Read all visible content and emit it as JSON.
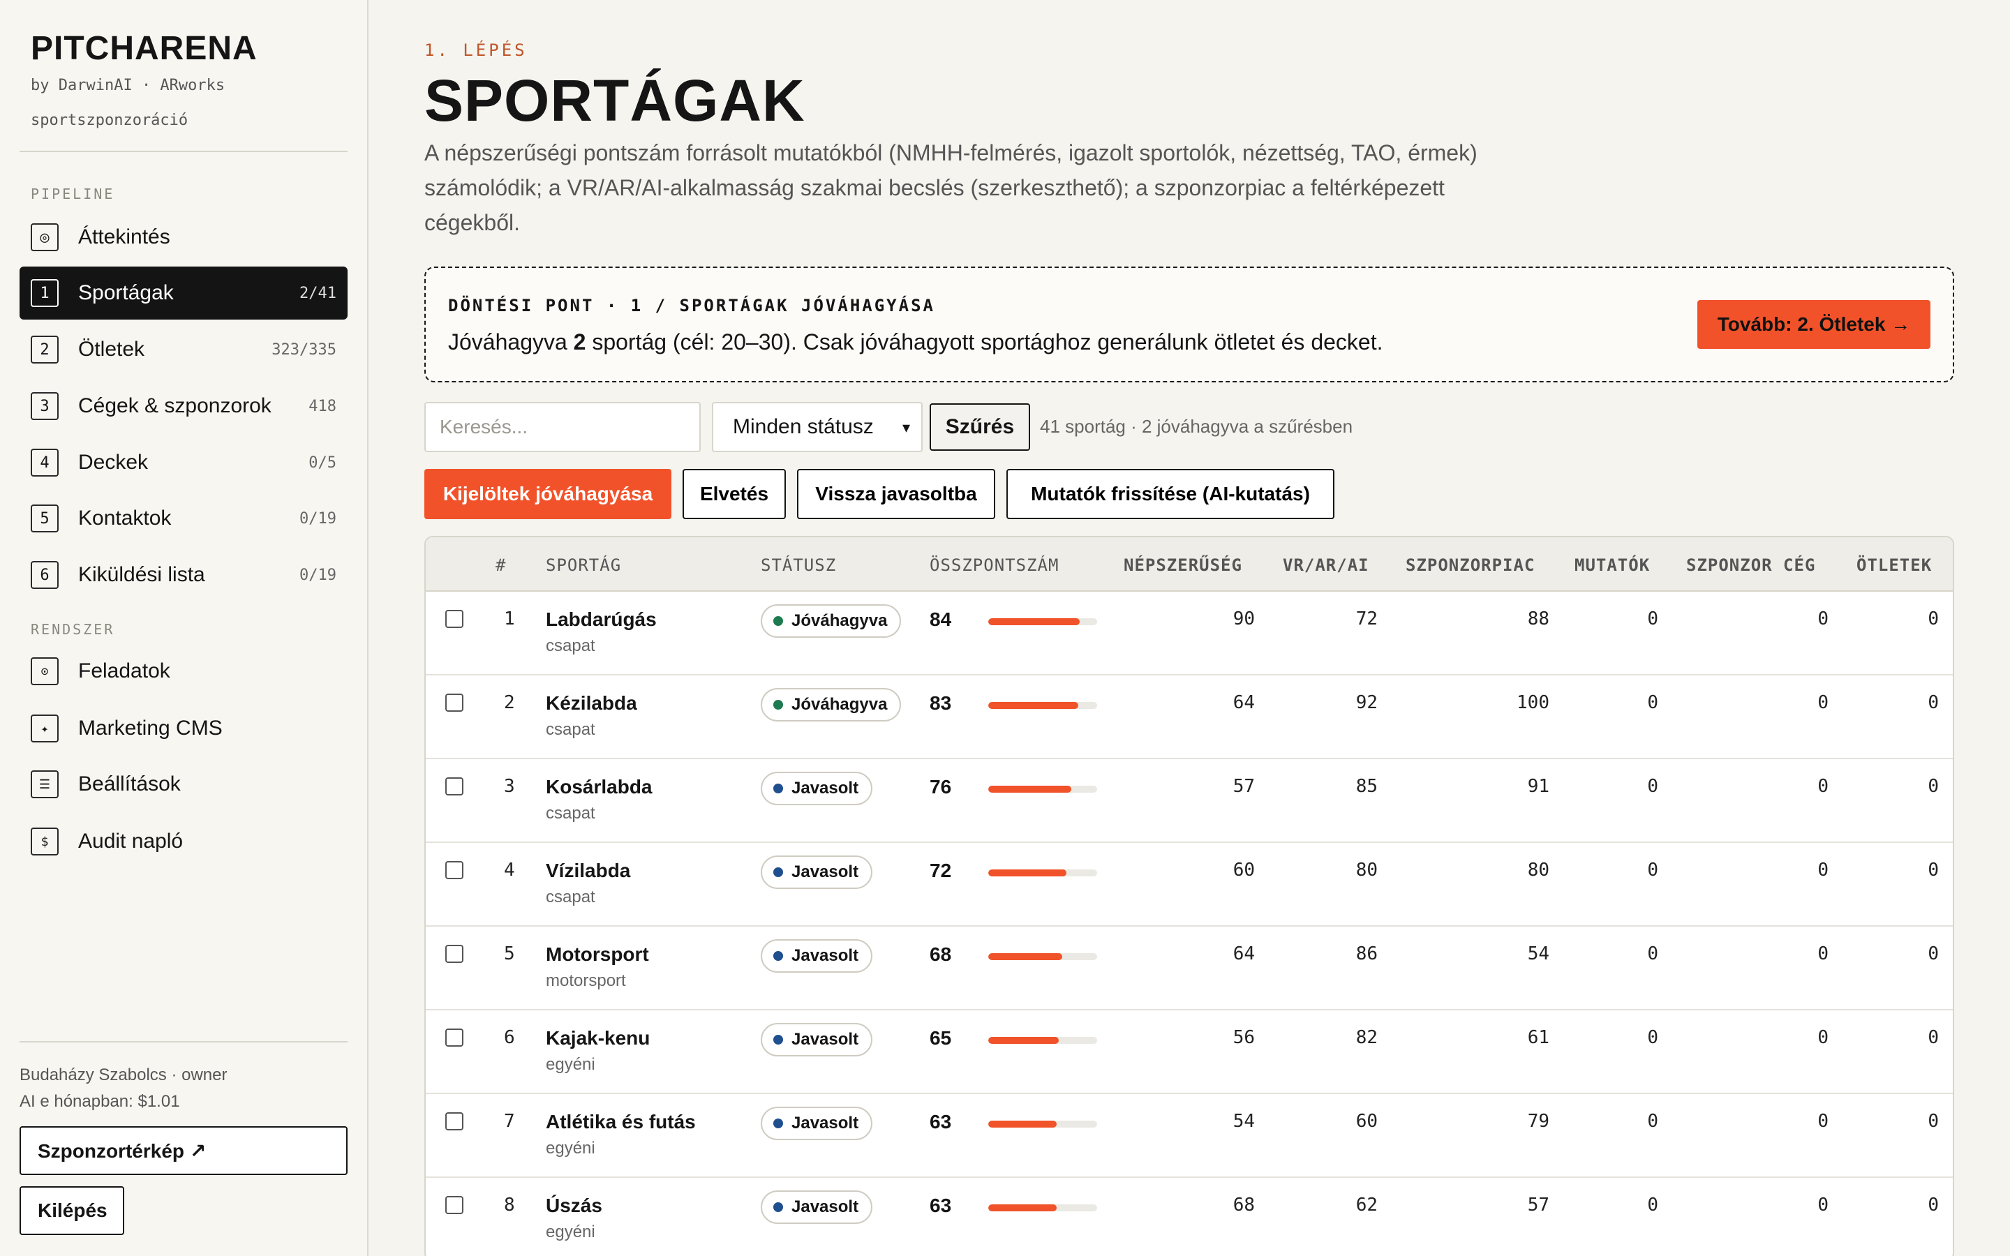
{
  "brand": {
    "title": "PITCHARENA",
    "sub": "by DarwinAI · ARworks",
    "sub2": "sportszponzoráció"
  },
  "sidebar": {
    "section_pipeline": "PIPELINE",
    "section_system": "RENDSZER",
    "pipeline_items": [
      {
        "icon": "◎",
        "label": "Áttekintés",
        "count": ""
      },
      {
        "icon": "1",
        "label": "Sportágak",
        "count": "2/41"
      },
      {
        "icon": "2",
        "label": "Ötletek",
        "count": "323/335"
      },
      {
        "icon": "3",
        "label": "Cégek & szponzorok",
        "count": "418"
      },
      {
        "icon": "4",
        "label": "Deckek",
        "count": "0/5"
      },
      {
        "icon": "5",
        "label": "Kontaktok",
        "count": "0/19"
      },
      {
        "icon": "6",
        "label": "Kiküldési lista",
        "count": "0/19"
      }
    ],
    "system_items": [
      {
        "icon": "⊙",
        "label": "Feladatok"
      },
      {
        "icon": "✦",
        "label": "Marketing CMS"
      },
      {
        "icon": "☰",
        "label": "Beállítások"
      },
      {
        "icon": "$",
        "label": "Audit napló"
      }
    ],
    "user": "Budaházy Szabolcs · owner",
    "ai_cost": "AI e hónapban: $1.01",
    "map_button": "Szponzortérkép ↗",
    "logout_button": "Kilépés"
  },
  "main": {
    "step": "1. LÉPÉS",
    "title": "SPORTÁGAK",
    "intro": "A népszerűségi pontszám forrásolt mutatókból (NMHH-felmérés, igazolt sportolók, nézettség, TAO, érmek) számolódik; a VR/AR/AI-alkalmasság szakmai becslés (szerkeszthető); a szponzorpiac a feltérképezett cégekből.",
    "decision": {
      "title": "DÖNTÉSI PONT · 1 / SPORTÁGAK JÓVÁHAGYÁSA",
      "text_pre": "Jóváhagyva ",
      "text_count": "2",
      "text_post": " sportág (cél: 20–30). Csak jóváhagyott sportághoz generálunk ötletet és decket.",
      "button": "Tovább: 2. Ötletek →"
    },
    "filters": {
      "search_placeholder": "Keresés...",
      "status_select": "Minden státusz",
      "filter_button": "Szűrés",
      "info": "41 sportág · 2 jóváhagyva a szűrésben"
    },
    "actions": {
      "approve": "Kijelöltek jóváhagyása",
      "reject": "Elvetés",
      "revert": "Vissza javasoltba",
      "refresh": "Mutatók frissítése (AI-kutatás)"
    }
  },
  "colors": {
    "accent": "#f2522a",
    "approved": "#1e7a4f",
    "suggested": "#1f4f8f"
  },
  "table": {
    "headers": [
      "#",
      "SPORTÁG",
      "STÁTUSZ",
      "ÖSSZPONTSZÁM",
      "NÉPSZERŰSÉG",
      "VR/AR/AI",
      "SZPONZORPIAC",
      "MUTATÓK",
      "SZPONZOR CÉG",
      "ÖTLETEK"
    ],
    "rows": [
      {
        "n": "1",
        "name": "Labdarúgás",
        "type": "csapat",
        "status": "Jóváhagyva",
        "approved": true,
        "score": 84,
        "pop": "90",
        "vr": "72",
        "market": "88",
        "metrics": "0",
        "company": "0",
        "ideas": "0"
      },
      {
        "n": "2",
        "name": "Kézilabda",
        "type": "csapat",
        "status": "Jóváhagyva",
        "approved": true,
        "score": 83,
        "pop": "64",
        "vr": "92",
        "market": "100",
        "metrics": "0",
        "company": "0",
        "ideas": "0"
      },
      {
        "n": "3",
        "name": "Kosárlabda",
        "type": "csapat",
        "status": "Javasolt",
        "approved": false,
        "score": 76,
        "pop": "57",
        "vr": "85",
        "market": "91",
        "metrics": "0",
        "company": "0",
        "ideas": "0"
      },
      {
        "n": "4",
        "name": "Vízilabda",
        "type": "csapat",
        "status": "Javasolt",
        "approved": false,
        "score": 72,
        "pop": "60",
        "vr": "80",
        "market": "80",
        "metrics": "0",
        "company": "0",
        "ideas": "0"
      },
      {
        "n": "5",
        "name": "Motorsport",
        "type": "motorsport",
        "status": "Javasolt",
        "approved": false,
        "score": 68,
        "pop": "64",
        "vr": "86",
        "market": "54",
        "metrics": "0",
        "company": "0",
        "ideas": "0"
      },
      {
        "n": "6",
        "name": "Kajak-kenu",
        "type": "egyéni",
        "status": "Javasolt",
        "approved": false,
        "score": 65,
        "pop": "56",
        "vr": "82",
        "market": "61",
        "metrics": "0",
        "company": "0",
        "ideas": "0"
      },
      {
        "n": "7",
        "name": "Atlétika és futás",
        "type": "egyéni",
        "status": "Javasolt",
        "approved": false,
        "score": 63,
        "pop": "54",
        "vr": "60",
        "market": "79",
        "metrics": "0",
        "company": "0",
        "ideas": "0"
      },
      {
        "n": "8",
        "name": "Úszás",
        "type": "egyéni",
        "status": "Javasolt",
        "approved": false,
        "score": 63,
        "pop": "68",
        "vr": "62",
        "market": "57",
        "metrics": "0",
        "company": "0",
        "ideas": "0"
      }
    ]
  }
}
